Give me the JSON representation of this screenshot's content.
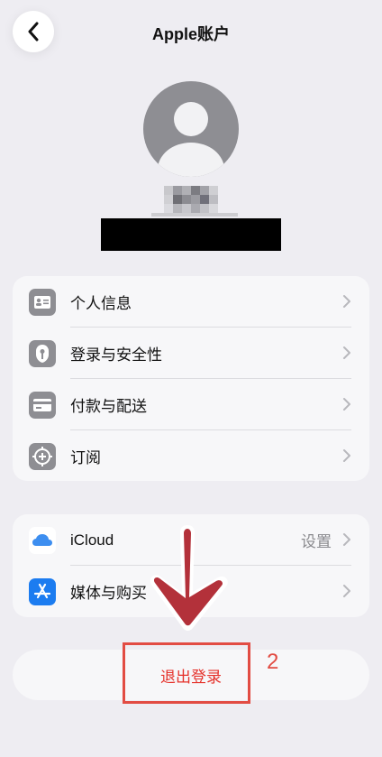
{
  "header": {
    "title": "Apple账户",
    "back_icon": "chevron-left-icon"
  },
  "profile": {
    "avatar_icon": "person-avatar-icon"
  },
  "group1": {
    "items": [
      {
        "label": "个人信息",
        "icon": "person-card-icon",
        "color": "#8e8e93"
      },
      {
        "label": "登录与安全性",
        "icon": "key-shield-icon",
        "color": "#8e8e93"
      },
      {
        "label": "付款与配送",
        "icon": "credit-card-icon",
        "color": "#8e8e93"
      },
      {
        "label": "订阅",
        "icon": "subscription-plus-icon",
        "color": "#8e8e93"
      }
    ]
  },
  "group2": {
    "items": [
      {
        "label": "iCloud",
        "detail": "设置",
        "icon": "cloud-icon",
        "color": "#3d8ef0"
      },
      {
        "label": "媒体与购买",
        "icon": "app-store-icon",
        "color": "#1c7cf0"
      }
    ]
  },
  "signout": {
    "label": "退出登录",
    "color": "#e5322b"
  },
  "annotation": {
    "step": "2",
    "color": "#e24c43"
  }
}
